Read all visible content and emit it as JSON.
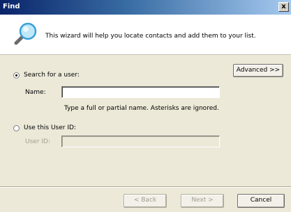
{
  "window": {
    "title": "Find",
    "close_label": "x"
  },
  "header": {
    "description": "This wizard will help you locate contacts and add them to your list."
  },
  "advanced_button": {
    "label": "Advanced >>"
  },
  "search_user": {
    "radio_label": "Search for a user:",
    "selected": true,
    "name_label": "Name:",
    "name_value": "",
    "hint": "Type a full or partial name.  Asterisks are ignored."
  },
  "user_id": {
    "radio_label": "Use this User ID:",
    "selected": false,
    "field_label": "User ID:",
    "field_value": ""
  },
  "footer": {
    "back_label": "< Back",
    "next_label": "Next >",
    "cancel_label": "Cancel"
  }
}
